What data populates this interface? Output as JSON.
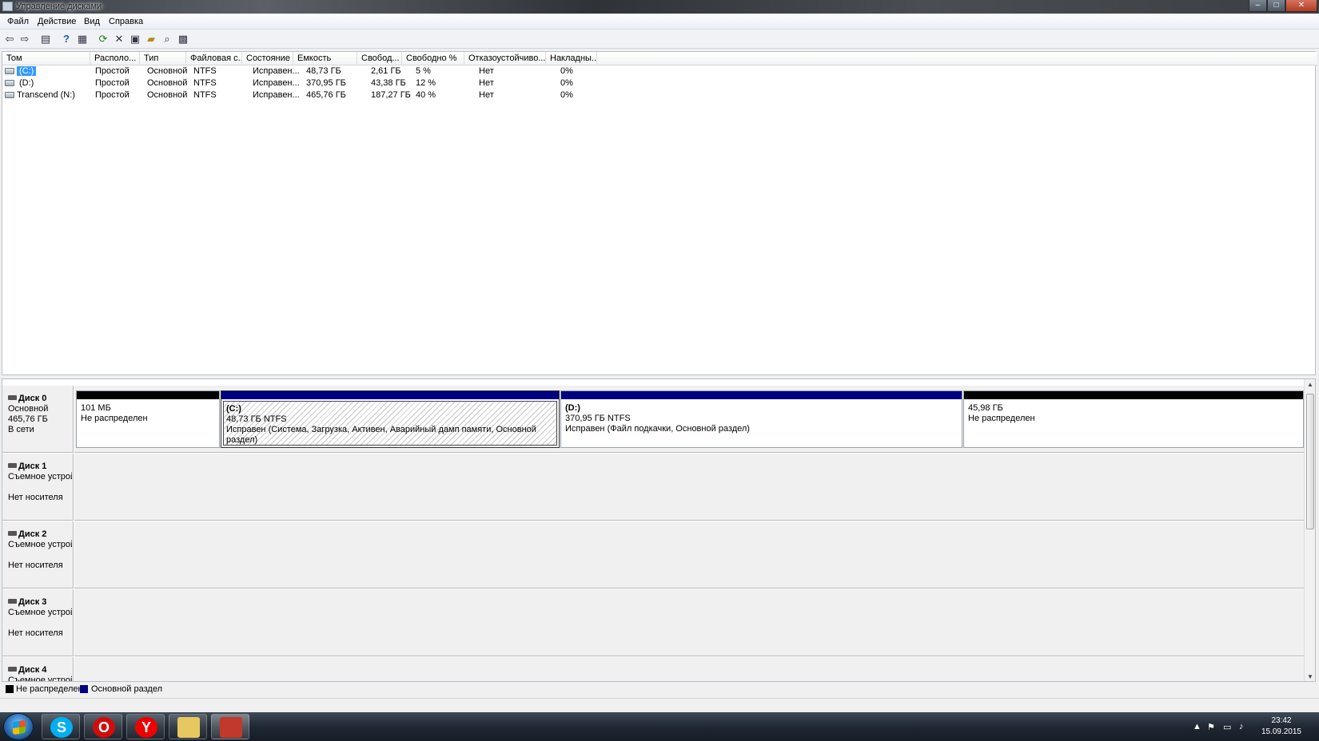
{
  "window": {
    "title": "Управление дисками",
    "minimize": "–",
    "maximize": "□",
    "close": "✕"
  },
  "menu": [
    "Файл",
    "Действие",
    "Вид",
    "Справка"
  ],
  "toolbar_icons": [
    "back-arrow-icon",
    "forward-arrow-icon",
    "console-tree-icon",
    "help-icon",
    "properties-icon",
    "refresh-icon",
    "delete-icon",
    "export-icon",
    "open-icon",
    "rescan-icon",
    "settings-icon"
  ],
  "columns": [
    "Том",
    "Располо...",
    "Тип",
    "Файловая с...",
    "Состояние",
    "Емкость",
    "Свобод...",
    "Свободно %",
    "Отказоустойчиво...",
    "Накладны..."
  ],
  "volumes": [
    {
      "name": "(C:)",
      "layout": "Простой",
      "type": "Основной",
      "fs": "NTFS",
      "status": "Исправен...",
      "capacity": "48,73 ГБ",
      "free": "2,61 ГБ",
      "free_pct": "5 %",
      "fault": "Нет",
      "overhead": "0%"
    },
    {
      "name": "(D:)",
      "layout": "Простой",
      "type": "Основной",
      "fs": "NTFS",
      "status": "Исправен...",
      "capacity": "370,95 ГБ",
      "free": "43,38 ГБ",
      "free_pct": "12 %",
      "fault": "Нет",
      "overhead": "0%"
    },
    {
      "name": "Transcend (N:)",
      "layout": "Простой",
      "type": "Основной",
      "fs": "NTFS",
      "status": "Исправен...",
      "capacity": "465,76 ГБ",
      "free": "187,27 ГБ",
      "free_pct": "40 %",
      "fault": "Нет",
      "overhead": "0%"
    }
  ],
  "disks": [
    {
      "name": "Диск 0",
      "kind": "Основной",
      "size": "465,76 ГБ",
      "state": "В сети",
      "partitions": [
        {
          "label": "",
          "size": "101 МБ",
          "status": "Не распределен"
        },
        {
          "label": "(C:)",
          "size": "48,73 ГБ NTFS",
          "status": "Исправен (Система, Загрузка, Активен, Аварийный дамп памяти, Основной раздел)"
        },
        {
          "label": "(D:)",
          "size": "370,95 ГБ NTFS",
          "status": "Исправен (Файл подкачки, Основной раздел)"
        },
        {
          "label": "",
          "size": "45,98 ГБ",
          "status": "Не распределен"
        }
      ]
    },
    {
      "name": "Диск 1",
      "kind": "Съемное устройство",
      "size": "",
      "state": "Нет носителя"
    },
    {
      "name": "Диск 2",
      "kind": "Съемное устройство",
      "size": "",
      "state": "Нет носителя"
    },
    {
      "name": "Диск 3",
      "kind": "Съемное устройство",
      "size": "",
      "state": "Нет носителя"
    },
    {
      "name": "Диск 4",
      "kind": "Съемное устройство",
      "size": "",
      "state": ""
    }
  ],
  "legend": [
    {
      "label": "Не распределен",
      "color": "#000000"
    },
    {
      "label": "Основной раздел",
      "color": "#000080"
    }
  ],
  "colors": {
    "unallocated": "#000000",
    "primary": "#000080",
    "selection": "#3399ff"
  },
  "taskbar": {
    "apps": [
      "skype-icon",
      "opera-icon",
      "yandex-icon",
      "explorer-icon",
      "disk-management-icon"
    ],
    "time": "23:42",
    "date": "15.09.2015"
  }
}
